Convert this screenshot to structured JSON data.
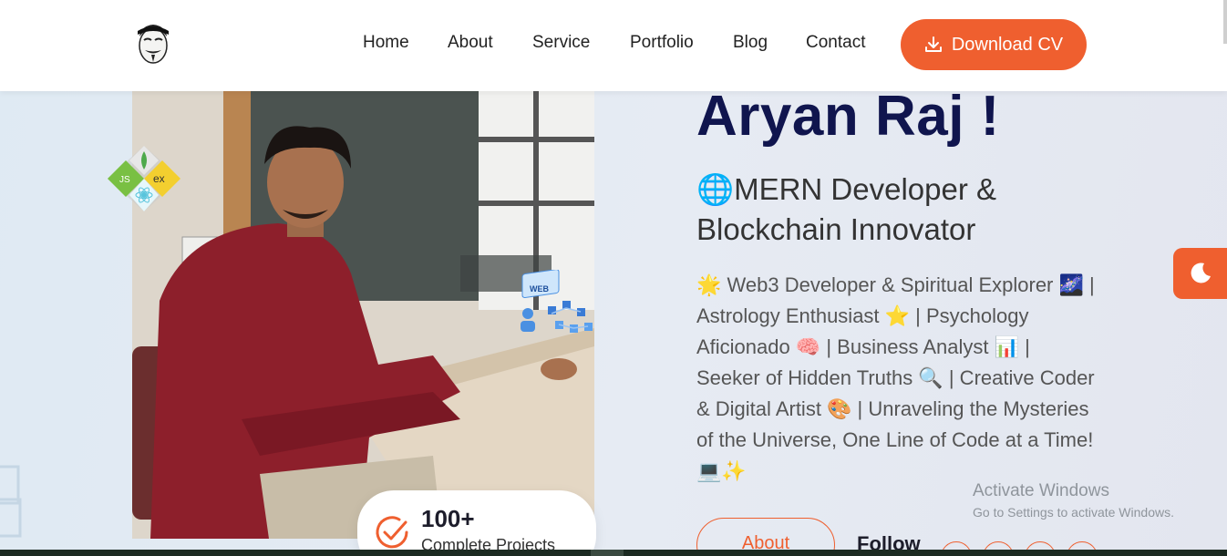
{
  "nav": {
    "links": [
      "Home",
      "About",
      "Service",
      "Portfolio",
      "Blog",
      "Contact"
    ],
    "cv_button": "Download CV",
    "logo_icon": "anonymous-mask-logo"
  },
  "hero": {
    "name": "Aryan Raj !",
    "role_line1": "🌐MERN Developer &",
    "role_line2": "Blockchain Innovator",
    "bio": "🌟 Web3 Developer & Spiritual Explorer 🌌 | Astrology Enthusiast ⭐ | Psychology Aficionado 🧠 | Business Analyst 📊 | Seeker of Hidden Truths 🔍 | Creative Coder & Digital Artist 🎨 | Unraveling the Mysteries of the Universe, One Line of Code at a Time! 💻✨",
    "about_button": "About",
    "follow_label": "Follow"
  },
  "projects_card": {
    "count": "100+",
    "label": "Complete Projects"
  },
  "tech_badge": {
    "labels": [
      "JS",
      "ex"
    ]
  },
  "web_icon": {
    "label": "WEB"
  },
  "watermark": {
    "title": "Activate Windows",
    "subtitle": "Go to Settings to activate Windows."
  },
  "colors": {
    "accent": "#ef5f2f",
    "name": "#10154e"
  }
}
